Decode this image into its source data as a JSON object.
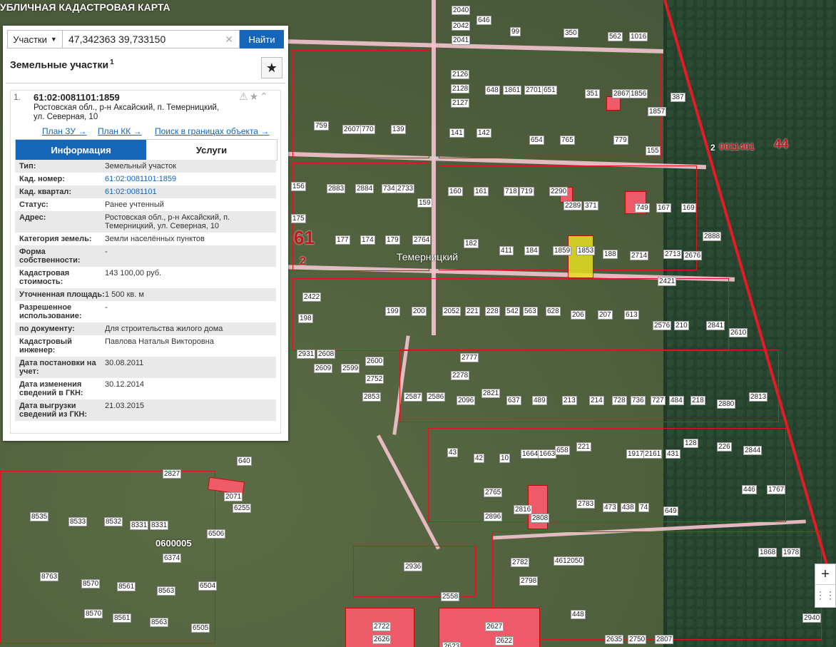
{
  "map": {
    "banner_title": "УБЛИЧНАЯ КАДАСТРОВАЯ КАРТА",
    "place_label": "Темерницкий",
    "quarter_big_label": "61",
    "quarter_small_label": "2",
    "district_label": "0011401",
    "district_num": "44",
    "district_small": "2",
    "quarter_lower": "0600005",
    "parcel_labels": [
      "2040",
      "2042",
      "646",
      "2041",
      "99",
      "350",
      "562",
      "1016",
      "2126",
      "2128",
      "2127",
      "648",
      "1861",
      "2701",
      "651",
      "351",
      "2867",
      "1856",
      "1857",
      "387",
      "759",
      "2607",
      "770",
      "139",
      "141",
      "142",
      "654",
      "765",
      "779",
      "155",
      "156",
      "2883",
      "2884",
      "734",
      "2733",
      "159",
      "160",
      "161",
      "718",
      "719",
      "2290",
      "2289",
      "371",
      "749",
      "167",
      "169",
      "2888",
      "175",
      "177",
      "174",
      "179",
      "2764",
      "182",
      "411",
      "184",
      "1859",
      "1853",
      "188",
      "2714",
      "2713",
      "2676",
      "2421",
      "2422",
      "198",
      "199",
      "200",
      "2052",
      "221",
      "228",
      "542",
      "563",
      "628",
      "206",
      "207",
      "613",
      "2576",
      "210",
      "2841",
      "2610",
      "2931",
      "2608",
      "2600",
      "2752",
      "2609",
      "2599",
      "2853",
      "2777",
      "2278",
      "2821",
      "2587",
      "2586",
      "2096",
      "637",
      "489",
      "213",
      "214",
      "728",
      "736",
      "727",
      "484",
      "218",
      "2880",
      "2813",
      "43",
      "42",
      "10",
      "1664",
      "1663",
      "658",
      "221",
      "1917",
      "2161",
      "431",
      "128",
      "226",
      "2844",
      "2765",
      "2896",
      "2816",
      "2808",
      "2783",
      "473",
      "438",
      "74",
      "649",
      "446",
      "1767",
      "640",
      "2827",
      "2071",
      "6255",
      "8535",
      "8533",
      "8532",
      "8331",
      "8331",
      "6506",
      "6374",
      "8763",
      "8570",
      "8561",
      "8563",
      "6504",
      "8570",
      "8561",
      "8563",
      "6505",
      "2936",
      "2558",
      "2782",
      "2798",
      "4612050",
      "448",
      "2722",
      "2626",
      "2627",
      "2622",
      "2623",
      "1868",
      "1978",
      "2807",
      "2750",
      "2635",
      "2940",
      "472"
    ]
  },
  "search": {
    "scope_label": "Участки",
    "value": "47,342363 39,733150",
    "button_label": "Найти"
  },
  "panel": {
    "title": "Земельные участки",
    "count_sup": "1"
  },
  "card": {
    "index": "1.",
    "cad_number": "61:02:0081101:1859",
    "address": "Ростовская обл., р-н Аксайский, п. Темерницкий, ул. Северная, 10",
    "link_plan_zu": "План ЗУ →",
    "link_plan_kk": "План КК →",
    "link_search": "Поиск в границах объекта →",
    "tab_info": "Информация",
    "tab_services": "Услуги",
    "rows": [
      {
        "k": "Тип:",
        "v": "Земельный участок"
      },
      {
        "k": "Кад. номер:",
        "v": "61:02:0081101:1859"
      },
      {
        "k": "Кад. квартал:",
        "v": "61:02:0081101"
      },
      {
        "k": "Статус:",
        "v": "Ранее учтенный"
      },
      {
        "k": "Адрес:",
        "v": "Ростовская обл., р-н Аксайский, п. Темерницкий, ул. Северная, 10"
      },
      {
        "k": "Категория земель:",
        "v": "Земли населённых пунктов"
      },
      {
        "k": "Форма собственности:",
        "v": "-"
      },
      {
        "k": "Кадастровая стоимость:",
        "v": "143 100,00 руб."
      },
      {
        "k": "Уточненная площадь:",
        "v": "1 500 кв. м"
      },
      {
        "k": "Разрешенное использование:",
        "v": "-"
      },
      {
        "k": "по документу:",
        "v": "Для строительства жилого дома"
      },
      {
        "k": "Кадастровый инженер:",
        "v": "Павлова Наталья Викторовна"
      },
      {
        "k": "Дата постановки на учет:",
        "v": "30.08.2011"
      },
      {
        "k": "Дата изменения сведений в ГКН:",
        "v": "30.12.2014"
      },
      {
        "k": "Дата выгрузки сведений из ГКН:",
        "v": "21.03.2015"
      }
    ]
  },
  "zoom": {
    "plus": "+",
    "more": "⋮⋮"
  }
}
